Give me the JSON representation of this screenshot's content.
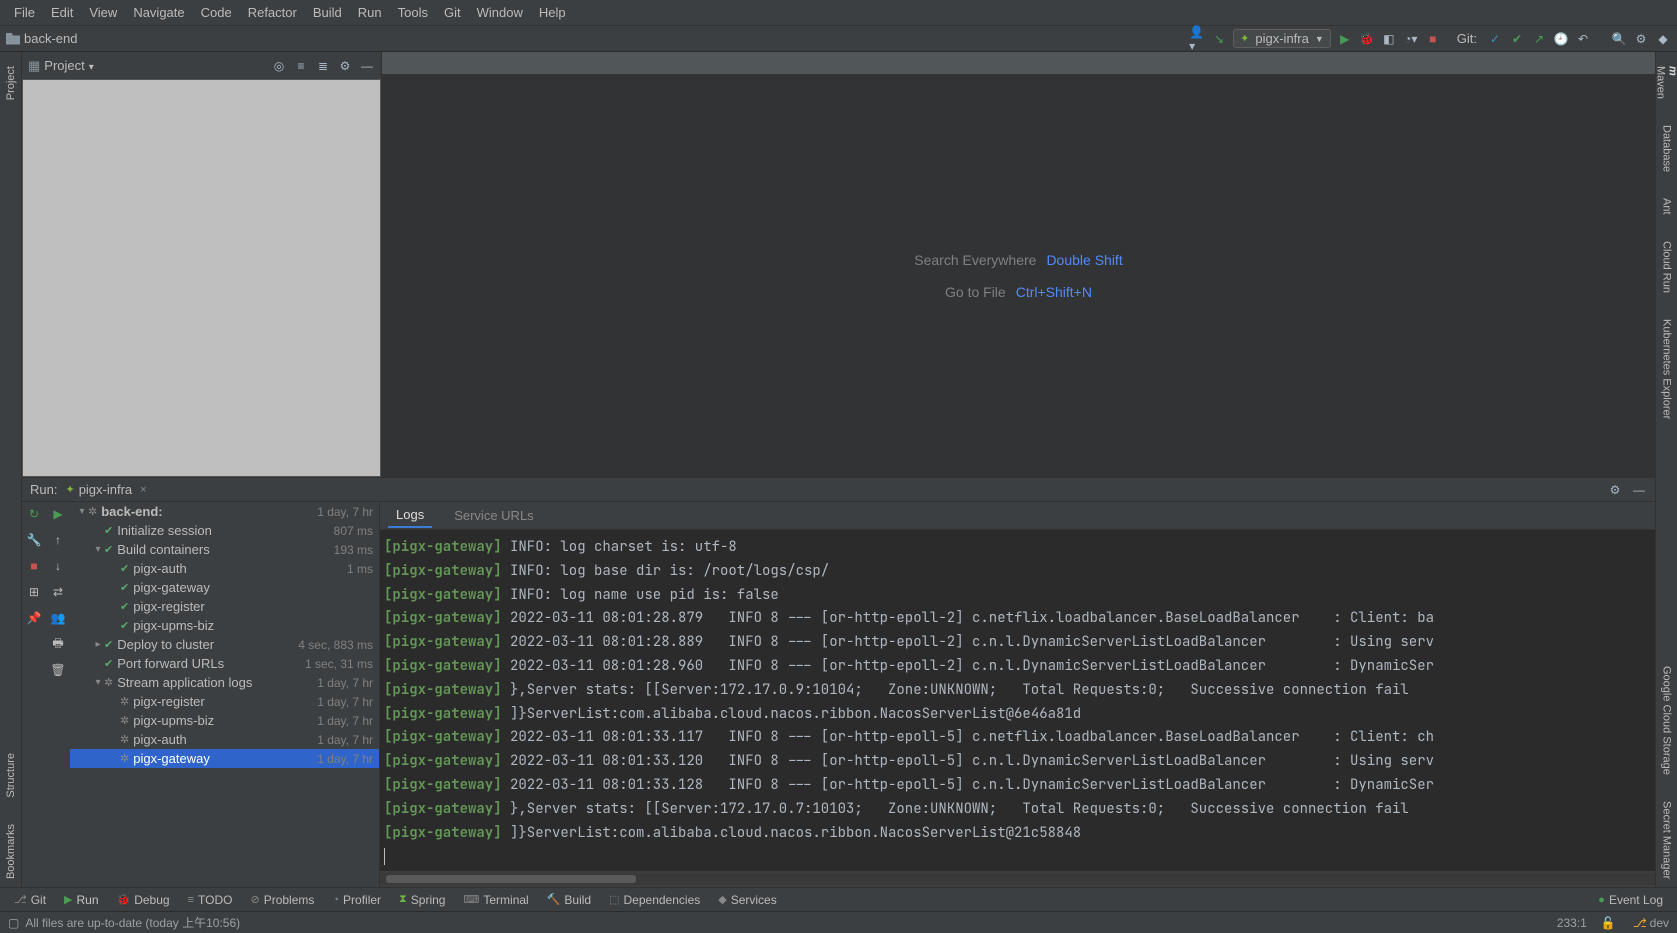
{
  "menu": {
    "file": "File",
    "edit": "Edit",
    "view": "View",
    "navigate": "Navigate",
    "code": "Code",
    "refactor": "Refactor",
    "build": "Build",
    "run": "Run",
    "tools": "Tools",
    "git": "Git",
    "window": "Window",
    "help": "Help"
  },
  "breadcrumb": {
    "project": "back-end"
  },
  "toolbar": {
    "run_config": "pigx-infra",
    "git_label": "Git:"
  },
  "project_panel": {
    "title": "Project"
  },
  "editor_hints": {
    "search_label": "Search Everywhere",
    "search_key": "Double Shift",
    "goto_label": "Go to File",
    "goto_key": "Ctrl+Shift+N"
  },
  "left_tabs": {
    "project": "Project",
    "structure": "Structure",
    "bookmarks": "Bookmarks"
  },
  "right_tabs": {
    "maven": "Maven",
    "database": "Database",
    "ant": "Ant",
    "cloudrun": "Cloud Run",
    "k8s": "Kubernetes Explorer",
    "gcs": "Google Cloud Storage",
    "secret": "Secret Manager"
  },
  "runwin": {
    "label": "Run:",
    "config_name": "pigx-infra",
    "tabs": {
      "logs": "Logs",
      "urls": "Service URLs"
    }
  },
  "tasks": [
    {
      "depth": 0,
      "expander": "v",
      "icon": "spinner",
      "label": "back-end:",
      "time": "1 day, 7 hr",
      "bold": true
    },
    {
      "depth": 1,
      "expander": "",
      "icon": "tick",
      "label": "Initialize session",
      "time": "807 ms"
    },
    {
      "depth": 1,
      "expander": "v",
      "icon": "tick",
      "label": "Build containers",
      "time": "193 ms"
    },
    {
      "depth": 2,
      "expander": "",
      "icon": "tick",
      "label": "pigx-auth",
      "time": "1 ms"
    },
    {
      "depth": 2,
      "expander": "",
      "icon": "tick",
      "label": "pigx-gateway",
      "time": ""
    },
    {
      "depth": 2,
      "expander": "",
      "icon": "tick",
      "label": "pigx-register",
      "time": ""
    },
    {
      "depth": 2,
      "expander": "",
      "icon": "tick",
      "label": "pigx-upms-biz",
      "time": ""
    },
    {
      "depth": 1,
      "expander": ">",
      "icon": "tick",
      "label": "Deploy to cluster",
      "time": "4 sec, 883 ms"
    },
    {
      "depth": 1,
      "expander": "",
      "icon": "tick",
      "label": "Port forward URLs",
      "time": "1 sec, 31 ms"
    },
    {
      "depth": 1,
      "expander": "v",
      "icon": "spinner",
      "label": "Stream application logs",
      "time": "1 day, 7 hr"
    },
    {
      "depth": 2,
      "expander": "",
      "icon": "spinner",
      "label": "pigx-register",
      "time": "1 day, 7 hr"
    },
    {
      "depth": 2,
      "expander": "",
      "icon": "spinner",
      "label": "pigx-upms-biz",
      "time": "1 day, 7 hr"
    },
    {
      "depth": 2,
      "expander": "",
      "icon": "spinner",
      "label": "pigx-auth",
      "time": "1 day, 7 hr"
    },
    {
      "depth": 2,
      "expander": "",
      "icon": "spinner",
      "label": "pigx-gateway",
      "time": "1 day, 7 hr",
      "selected": true
    }
  ],
  "logs": [
    {
      "prefix": "[pigx-gateway]",
      "text": " INFO: log charset is: utf-8"
    },
    {
      "prefix": "[pigx-gateway]",
      "text": " INFO: log base dir is: /root/logs/csp/"
    },
    {
      "prefix": "[pigx-gateway]",
      "text": " INFO: log name use pid is: false"
    },
    {
      "prefix": "[pigx-gateway]",
      "text": " 2022-03-11 08:01:28.879   INFO 8 --- [or-http-epoll-2] c.netflix.loadbalancer.BaseLoadBalancer    : Client: ba"
    },
    {
      "prefix": "[pigx-gateway]",
      "text": " 2022-03-11 08:01:28.889   INFO 8 --- [or-http-epoll-2] c.n.l.DynamicServerListLoadBalancer        : Using serv"
    },
    {
      "prefix": "[pigx-gateway]",
      "text": " 2022-03-11 08:01:28.960   INFO 8 --- [or-http-epoll-2] c.n.l.DynamicServerListLoadBalancer        : DynamicSer"
    },
    {
      "prefix": "[pigx-gateway]",
      "text": " },Server stats: [[Server:172.17.0.9:10104;   Zone:UNKNOWN;   Total Requests:0;   Successive connection fail"
    },
    {
      "prefix": "[pigx-gateway]",
      "text": " ]}ServerList:com.alibaba.cloud.nacos.ribbon.NacosServerList@6e46a81d"
    },
    {
      "prefix": "[pigx-gateway]",
      "text": " 2022-03-11 08:01:33.117   INFO 8 --- [or-http-epoll-5] c.netflix.loadbalancer.BaseLoadBalancer    : Client: ch"
    },
    {
      "prefix": "[pigx-gateway]",
      "text": " 2022-03-11 08:01:33.120   INFO 8 --- [or-http-epoll-5] c.n.l.DynamicServerListLoadBalancer        : Using serv"
    },
    {
      "prefix": "[pigx-gateway]",
      "text": " 2022-03-11 08:01:33.128   INFO 8 --- [or-http-epoll-5] c.n.l.DynamicServerListLoadBalancer        : DynamicSer"
    },
    {
      "prefix": "[pigx-gateway]",
      "text": " },Server stats: [[Server:172.17.0.7:10103;   Zone:UNKNOWN;   Total Requests:0;   Successive connection fail"
    },
    {
      "prefix": "[pigx-gateway]",
      "text": " ]}ServerList:com.alibaba.cloud.nacos.ribbon.NacosServerList@21c58848"
    }
  ],
  "bottom_tabs": {
    "git": "Git",
    "run": "Run",
    "debug": "Debug",
    "todo": "TODO",
    "problems": "Problems",
    "profiler": "Profiler",
    "spring": "Spring",
    "terminal": "Terminal",
    "build": "Build",
    "dependencies": "Dependencies",
    "services": "Services",
    "eventlog": "Event Log"
  },
  "status": {
    "msg": "All files are up-to-date (today 上午10:56)",
    "line_col": "233:1",
    "branch": "dev"
  }
}
